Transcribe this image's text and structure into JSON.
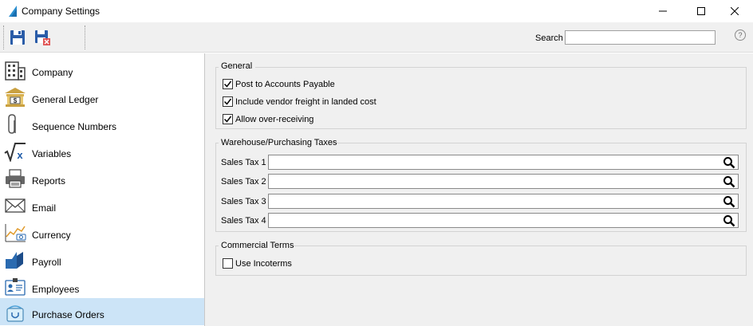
{
  "window": {
    "title": "Company Settings",
    "colors": {
      "accent": "#cce4f7",
      "icon_blue": "#2a5ca8"
    }
  },
  "toolbar": {
    "save_icon": "save-icon",
    "save_close_icon": "save-close-icon",
    "search_label": "Search",
    "search_value": "",
    "help_glyph": "?"
  },
  "sidebar": {
    "items": [
      {
        "label": "Company",
        "icon": "building-icon"
      },
      {
        "label": "General Ledger",
        "icon": "bank-icon"
      },
      {
        "label": "Sequence Numbers",
        "icon": "paperclip-icon"
      },
      {
        "label": "Variables",
        "icon": "sqrt-x-icon"
      },
      {
        "label": "Reports",
        "icon": "printer-icon"
      },
      {
        "label": "Email",
        "icon": "envelope-icon"
      },
      {
        "label": "Currency",
        "icon": "currency-chart-icon"
      },
      {
        "label": "Payroll",
        "icon": "payroll-icon"
      },
      {
        "label": "Employees",
        "icon": "id-card-icon"
      },
      {
        "label": "Purchase Orders",
        "icon": "purchase-bag-icon"
      }
    ],
    "selected": "Purchase Orders"
  },
  "main": {
    "general": {
      "title": "General",
      "options": [
        {
          "label": "Post to Accounts Payable",
          "checked": true
        },
        {
          "label": "Include vendor freight in landed cost",
          "checked": true
        },
        {
          "label": "Allow over-receiving",
          "checked": true
        }
      ]
    },
    "taxes": {
      "title": "Warehouse/Purchasing Taxes",
      "fields": [
        {
          "label": "Sales Tax 1",
          "value": ""
        },
        {
          "label": "Sales Tax 2",
          "value": ""
        },
        {
          "label": "Sales Tax 3",
          "value": ""
        },
        {
          "label": "Sales Tax 4",
          "value": ""
        }
      ]
    },
    "commercial": {
      "title": "Commercial Terms",
      "options": [
        {
          "label": "Use Incoterms",
          "checked": false
        }
      ]
    }
  }
}
